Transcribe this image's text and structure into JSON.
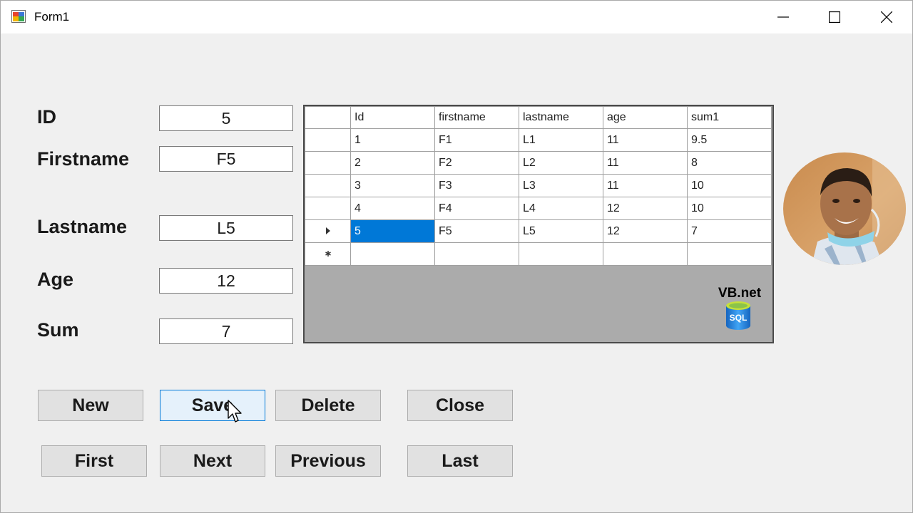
{
  "window": {
    "title": "Form1",
    "controls": [
      "minimize-icon",
      "maximize-icon",
      "close-icon"
    ]
  },
  "form": {
    "id": {
      "label": "ID",
      "value": "5"
    },
    "firstname": {
      "label": "Firstname",
      "value": "F5"
    },
    "lastname": {
      "label": "Lastname",
      "value": "L5"
    },
    "age": {
      "label": "Age",
      "value": "12"
    },
    "sum": {
      "label": "Sum",
      "value": "7"
    }
  },
  "grid": {
    "columns": [
      "Id",
      "firstname",
      "lastname",
      "age",
      "sum1"
    ],
    "rows": [
      [
        "1",
        "F1",
        "L1",
        "11",
        "9.5"
      ],
      [
        "2",
        "F2",
        "L2",
        "11",
        "8"
      ],
      [
        "3",
        "F3",
        "L3",
        "11",
        "10"
      ],
      [
        "4",
        "F4",
        "L4",
        "12",
        "10"
      ],
      [
        "5",
        "F5",
        "L5",
        "12",
        "7"
      ]
    ],
    "current_row_marker": "triangle-right-icon",
    "new_row_marker": "asterisk-icon",
    "selected_row": 5,
    "selected_column": "Id",
    "selection_color": "#0078d7"
  },
  "logo": {
    "text": "VB.net",
    "db_text": "SQL",
    "db_color": "#1e88e5"
  },
  "buttons": {
    "new": "New",
    "save": "Save",
    "delete": "Delete",
    "close": "Close",
    "first": "First",
    "next": "Next",
    "previous": "Previous",
    "last": "Last",
    "focused": "Save"
  }
}
